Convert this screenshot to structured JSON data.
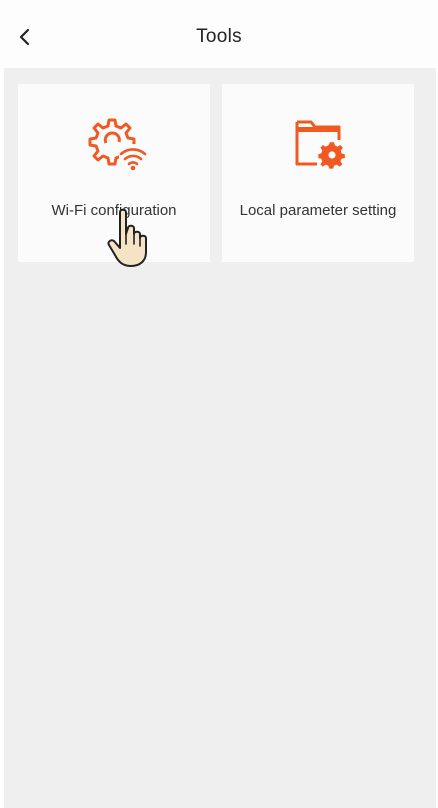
{
  "header": {
    "back_icon": "chevron-left-icon",
    "title": "Tools"
  },
  "tools": [
    {
      "label": "Wi-Fi configuration",
      "icon": "gear-wifi-icon"
    },
    {
      "label": "Local parameter setting",
      "icon": "folder-gear-icon"
    }
  ],
  "cursor": {
    "icon": "hand-pointer-icon"
  },
  "colors": {
    "accent": "#f05a22",
    "background": "#efefef",
    "card": "#fbfbfb",
    "text": "#333333"
  }
}
